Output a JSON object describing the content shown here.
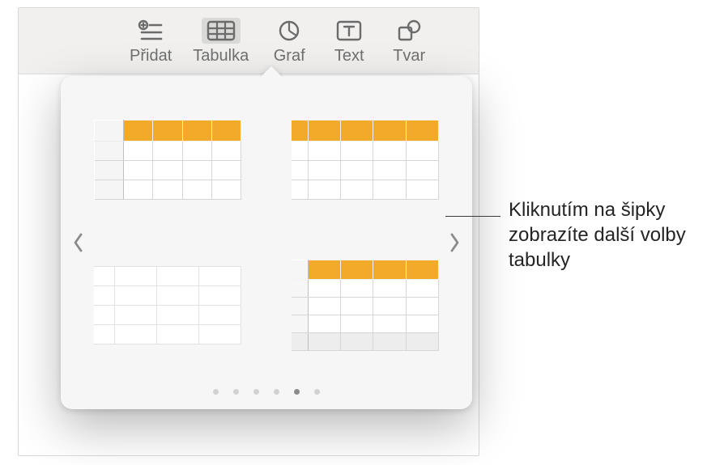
{
  "toolbar": {
    "items": [
      {
        "label": "Přidat",
        "icon": "list-plus-icon"
      },
      {
        "label": "Tabulka",
        "icon": "table-icon",
        "active": true
      },
      {
        "label": "Graf",
        "icon": "pie-chart-icon"
      },
      {
        "label": "Text",
        "icon": "text-box-icon"
      },
      {
        "label": "Tvar",
        "icon": "shapes-icon"
      }
    ]
  },
  "popover": {
    "accent_color": "#f2aa28",
    "active_page_index": 4,
    "page_count": 6,
    "styles": [
      {
        "id": "style-header-and-column",
        "has_header_row": true,
        "has_header_col": true,
        "has_footer": false
      },
      {
        "id": "style-header-only",
        "has_header_row": true,
        "has_header_col": false,
        "has_footer": false
      },
      {
        "id": "style-plain",
        "has_header_row": false,
        "has_header_col": false,
        "has_footer": false
      },
      {
        "id": "style-header-col-footer",
        "has_header_row": true,
        "has_header_col": true,
        "has_footer": true
      }
    ]
  },
  "callout": {
    "text": "Kliknutím na šipky zobrazíte další volby tabulky"
  }
}
